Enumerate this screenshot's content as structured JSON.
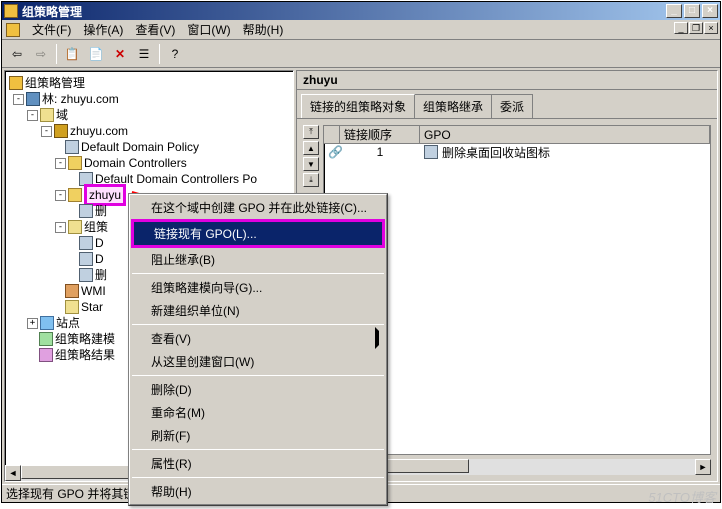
{
  "title": "组策略管理",
  "menus": {
    "file": "文件(F)",
    "action": "操作(A)",
    "view": "查看(V)",
    "window": "窗口(W)",
    "help": "帮助(H)"
  },
  "tree": {
    "root": "组策略管理",
    "forest": "林: zhuyu.com",
    "domains": "域",
    "domain": "zhuyu.com",
    "ddp": "Default Domain Policy",
    "dc": "Domain Controllers",
    "ddcp": "Default Domain Controllers Po",
    "zhuyu": "zhuyu",
    "zhuyu_child": "删",
    "gp_objects": "组策",
    "gp_d": "D",
    "gp_d2": "D",
    "gp_del": "删",
    "wmi": "WMI ",
    "star": "Star",
    "sites": "站点",
    "modeling": "组策略建模",
    "results": "组策略结果"
  },
  "right": {
    "header": "zhuyu",
    "tabs": {
      "linked": "链接的组策略对象",
      "inherit": "组策略继承",
      "delegate": "委派"
    },
    "cols": {
      "order": "链接顺序",
      "gpo": "GPO"
    },
    "row": {
      "order": "1",
      "gpo": "删除桌面回收站图标"
    }
  },
  "context": {
    "create": "在这个域中创建 GPO 并在此处链接(C)...",
    "link": "链接现有 GPO(L)...",
    "block": "阻止继承(B)",
    "wizard": "组策略建模向导(G)...",
    "newou": "新建组织单位(N)",
    "view": "查看(V)",
    "newwin": "从这里创建窗口(W)",
    "delete": "删除(D)",
    "rename": "重命名(M)",
    "refresh": "刷新(F)",
    "props": "属性(R)",
    "help": "帮助(H)"
  },
  "status": "选择现有 GPO 并将其链接到此容器",
  "watermark": "51CTO博客"
}
